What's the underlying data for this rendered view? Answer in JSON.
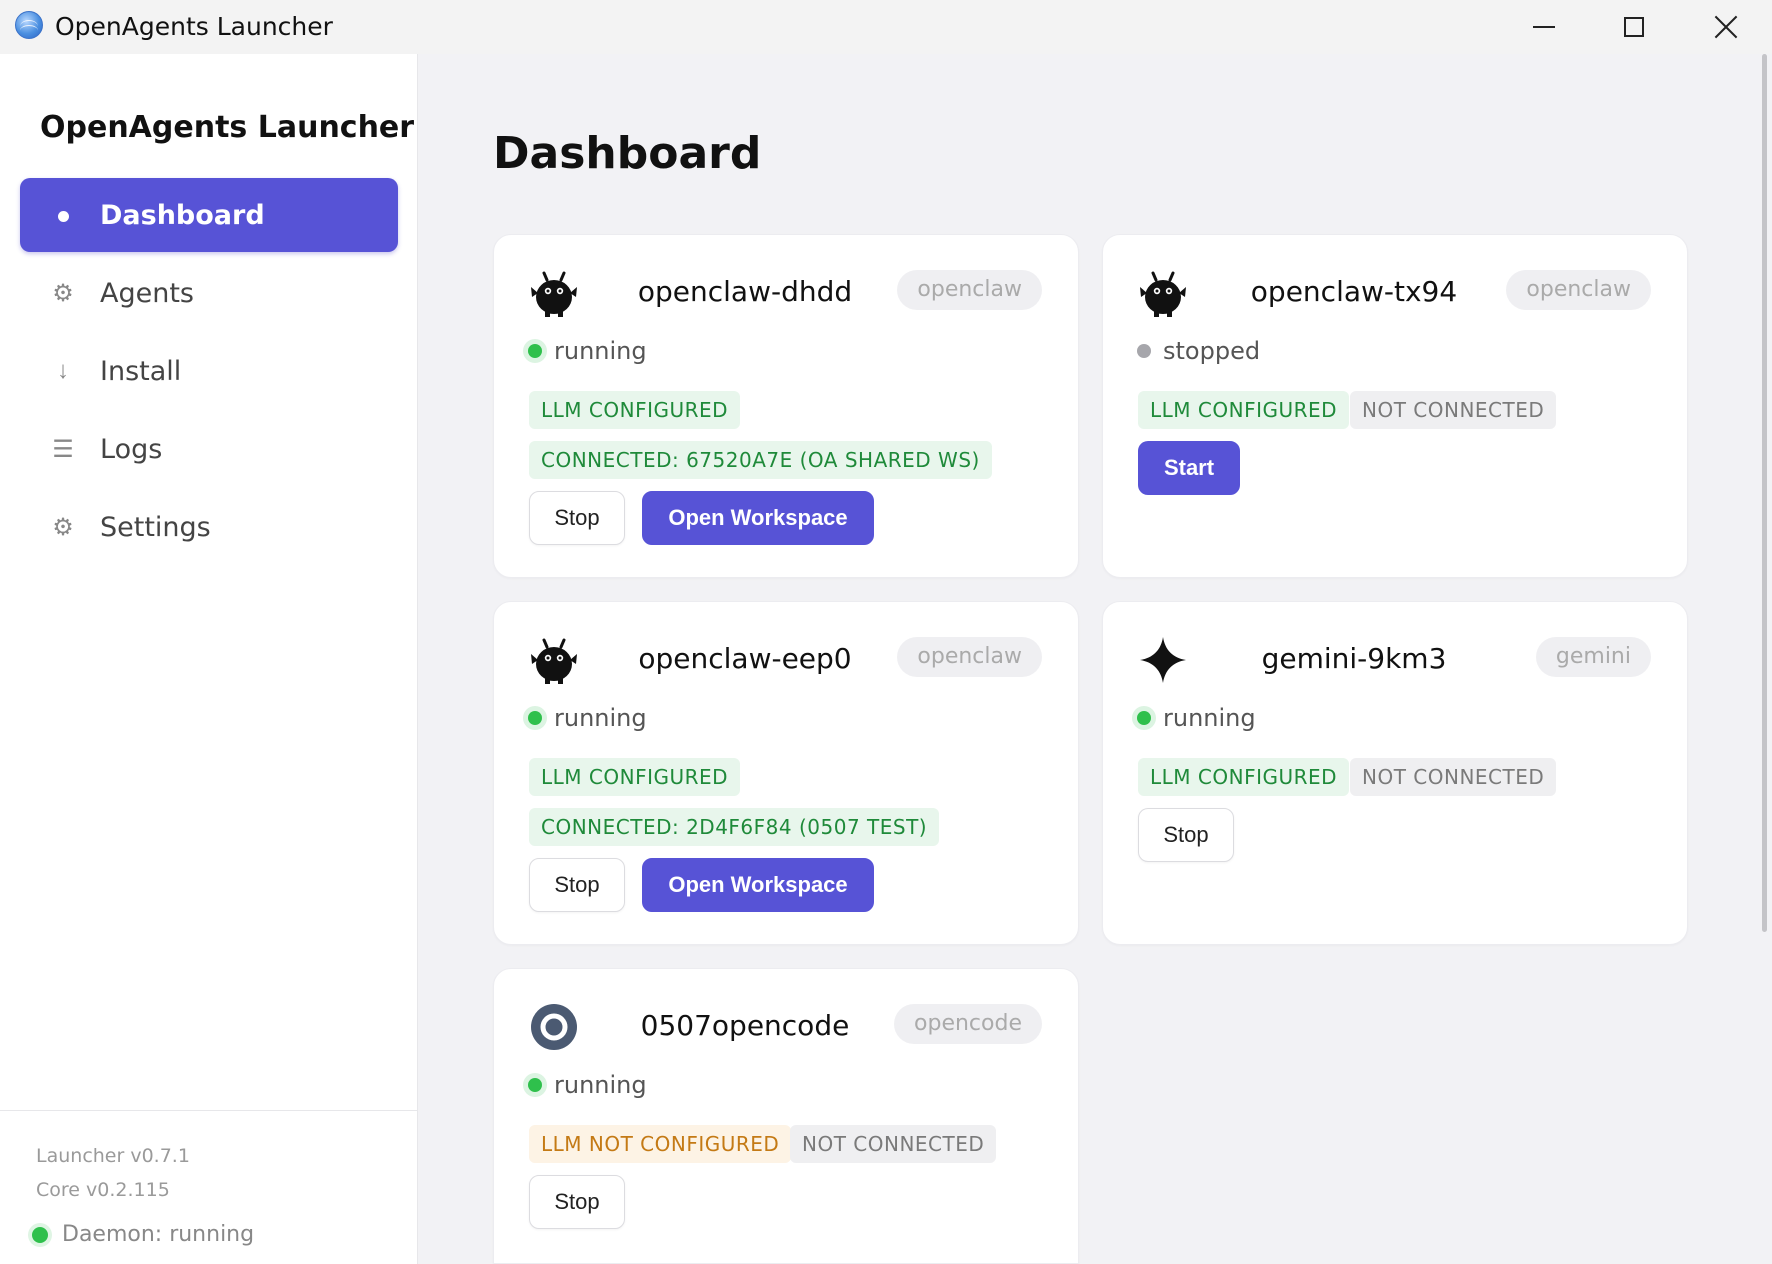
{
  "window": {
    "title": "OpenAgents Launcher"
  },
  "sidebar": {
    "brand": "OpenAgents Launcher",
    "items": [
      {
        "label": "Dashboard",
        "icon": "dot-icon",
        "active": true
      },
      {
        "label": "Agents",
        "icon": "gear-icon"
      },
      {
        "label": "Install",
        "icon": "arrow-down-icon"
      },
      {
        "label": "Logs",
        "icon": "list-icon"
      },
      {
        "label": "Settings",
        "icon": "gear-icon"
      }
    ],
    "launcher_version": "Launcher v0.7.1",
    "core_version": "Core v0.2.115",
    "daemon_status": "Daemon: running"
  },
  "main": {
    "title": "Dashboard",
    "agents": [
      {
        "name": "openclaw-dhdd",
        "type": "openclaw",
        "icon": "openclaw-icon",
        "status": "running",
        "badges": [
          "LLM CONFIGURED",
          "CONNECTED: 67520A7E (OA SHARED WS)"
        ],
        "buttons": [
          "Stop",
          "Open Workspace"
        ]
      },
      {
        "name": "openclaw-tx94",
        "type": "openclaw",
        "icon": "openclaw-icon",
        "status": "stopped",
        "badges": [
          "LLM CONFIGURED",
          "NOT CONNECTED"
        ],
        "buttons": [
          "Start"
        ]
      },
      {
        "name": "openclaw-eep0",
        "type": "openclaw",
        "icon": "openclaw-icon",
        "status": "running",
        "badges": [
          "LLM CONFIGURED",
          "CONNECTED: 2D4F6F84 (0507 TEST)"
        ],
        "buttons": [
          "Stop",
          "Open Workspace"
        ]
      },
      {
        "name": "gemini-9km3",
        "type": "gemini",
        "icon": "gemini-sparkle-icon",
        "status": "running",
        "badges": [
          "LLM CONFIGURED",
          "NOT CONNECTED"
        ],
        "buttons": [
          "Stop"
        ]
      },
      {
        "name": "0507opencode",
        "type": "opencode",
        "icon": "opencode-icon",
        "status": "running",
        "badges": [
          "LLM NOT CONFIGURED",
          "NOT CONNECTED"
        ],
        "buttons": [
          "Stop"
        ]
      }
    ]
  },
  "colors": {
    "accent": "#5753d6",
    "running": "#2fc04c",
    "stopped": "#a6a6ab",
    "badge_green_text": "#1f8a3a",
    "badge_orange_text": "#c47a15"
  }
}
